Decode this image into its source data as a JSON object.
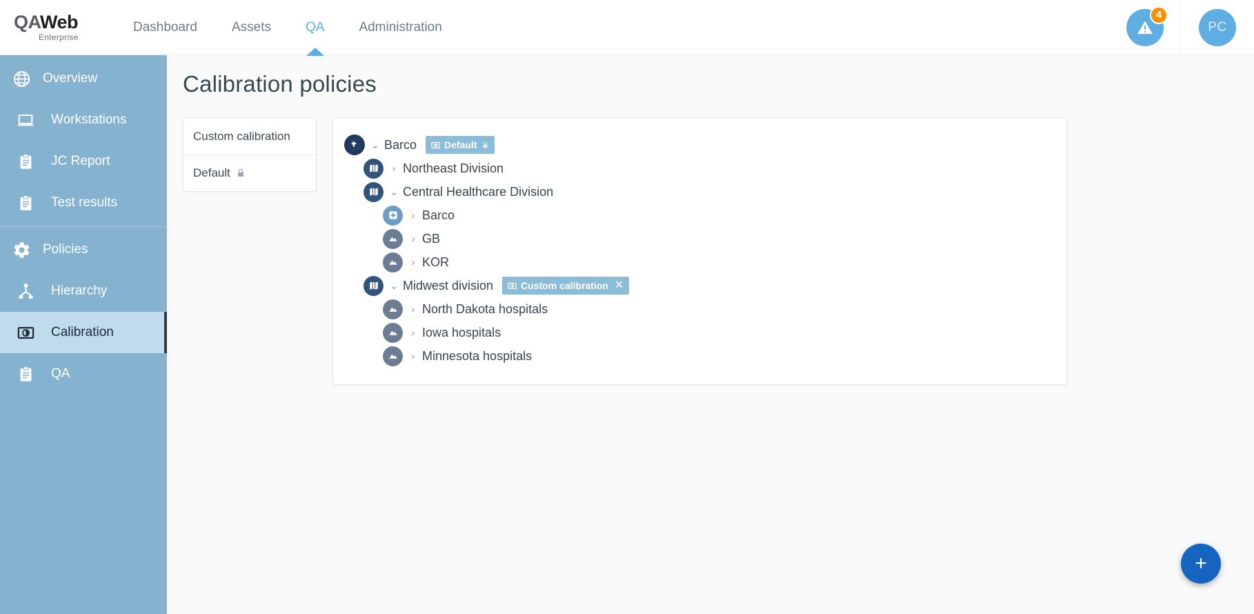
{
  "app": {
    "logo_main_qa": "QA",
    "logo_main_web": "Web",
    "logo_sub": "Enterprise"
  },
  "topnav": {
    "items": [
      {
        "label": "Dashboard",
        "active": false
      },
      {
        "label": "Assets",
        "active": false
      },
      {
        "label": "QA",
        "active": true
      },
      {
        "label": "Administration",
        "active": false
      }
    ],
    "alert_count": "4",
    "avatar_initials": "PC"
  },
  "sidebar": {
    "items": [
      {
        "label": "Overview",
        "icon": "globe-icon",
        "indent": false,
        "active": false
      },
      {
        "label": "Workstations",
        "icon": "laptop-icon",
        "indent": true,
        "active": false
      },
      {
        "label": "JC Report",
        "icon": "clipboard-icon",
        "indent": true,
        "active": false
      },
      {
        "label": "Test results",
        "icon": "clipboard-icon",
        "indent": true,
        "active": false
      },
      {
        "label": "Policies",
        "icon": "gear-icon",
        "indent": false,
        "active": false
      },
      {
        "label": "Hierarchy",
        "icon": "hierarchy-icon",
        "indent": true,
        "active": false
      },
      {
        "label": "Calibration",
        "icon": "calibration-icon",
        "indent": true,
        "active": true
      },
      {
        "label": "QA",
        "icon": "clipboard-icon",
        "indent": true,
        "active": false
      }
    ]
  },
  "page": {
    "title": "Calibration policies"
  },
  "policy_list": {
    "items": [
      {
        "label": "Custom calibration",
        "locked": false
      },
      {
        "label": "Default",
        "locked": true
      }
    ]
  },
  "tree": {
    "nodes": [
      {
        "label": "Barco",
        "depth": 0,
        "icon": "globe-node-icon",
        "icon_kind": "root",
        "expanded": true,
        "badge": {
          "label": "Default",
          "locked": true,
          "closable": false
        }
      },
      {
        "label": "Northeast Division",
        "depth": 1,
        "icon": "map-node-icon",
        "icon_kind": "div",
        "expanded": false,
        "badge": null
      },
      {
        "label": "Central Healthcare Division",
        "depth": 1,
        "icon": "map-node-icon",
        "icon_kind": "div",
        "expanded": true,
        "badge": null
      },
      {
        "label": "Barco",
        "depth": 2,
        "icon": "hospital-node-icon",
        "icon_kind": "hosp",
        "expanded": false,
        "badge": null
      },
      {
        "label": "GB",
        "depth": 2,
        "icon": "site-node-icon",
        "icon_kind": "site",
        "expanded": false,
        "badge": null
      },
      {
        "label": "KOR",
        "depth": 2,
        "icon": "site-node-icon",
        "icon_kind": "site",
        "expanded": false,
        "badge": null
      },
      {
        "label": "Midwest division",
        "depth": 1,
        "icon": "map-node-icon",
        "icon_kind": "div",
        "expanded": true,
        "badge": {
          "label": "Custom calibration",
          "locked": false,
          "closable": true
        }
      },
      {
        "label": "North Dakota hospitals",
        "depth": 2,
        "icon": "site-node-icon",
        "icon_kind": "site",
        "expanded": false,
        "badge": null
      },
      {
        "label": "Iowa hospitals",
        "depth": 2,
        "icon": "site-node-icon",
        "icon_kind": "site",
        "expanded": false,
        "badge": null
      },
      {
        "label": "Minnesota hospitals",
        "depth": 2,
        "icon": "site-node-icon",
        "icon_kind": "site",
        "expanded": false,
        "badge": null
      }
    ]
  },
  "fab": {
    "label": "+",
    "icon": "plus-icon"
  },
  "colors": {
    "accent": "#5faee3",
    "sidebar": "#84b2cf",
    "sidebar_active": "#bfdcec",
    "badge": "#8bbcd8",
    "alert_badge": "#f39200",
    "fab": "#1565c0"
  }
}
